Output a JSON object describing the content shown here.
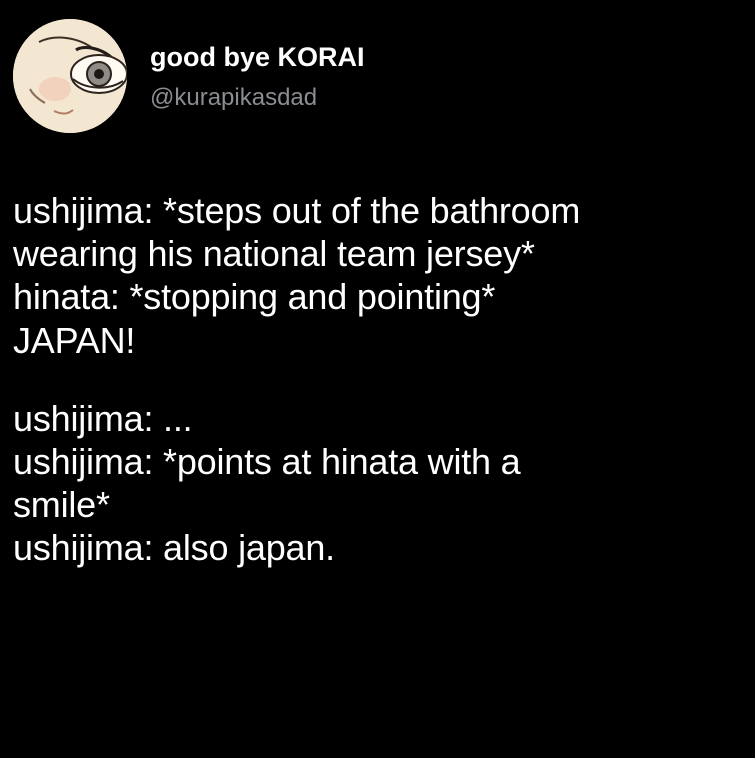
{
  "tweet": {
    "display_name": "good bye KORAI",
    "handle": "@kurapikasdad",
    "avatar_icon": "avatar-face-icon",
    "paragraphs": [
      [
        "ushijima: *steps out of the bathroom",
        "wearing his national team jersey*",
        "hinata: *stopping and pointing*",
        "JAPAN!"
      ],
      [
        "ushijima: ...",
        "ushijima: *points at hinata with a",
        "smile*",
        "ushijima: also japan."
      ]
    ]
  },
  "colors": {
    "background": "#000000",
    "text": "#ffffff",
    "handle": "#8a8d91"
  }
}
